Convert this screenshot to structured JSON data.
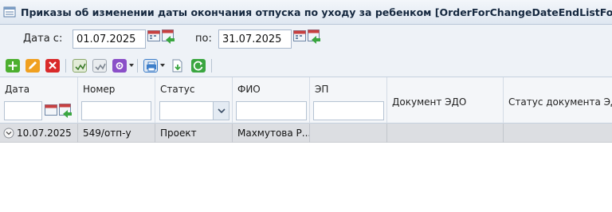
{
  "window": {
    "title": "Приказы об изменении даты окончания отпуска по уходу за ребенком [OrderForChangeDateEndListForm]",
    "icon": "list-window-icon"
  },
  "filter": {
    "date_from_label": "Дата с:",
    "date_from_value": "01.07.2025",
    "date_to_label": "по:",
    "date_to_value": "31.07.2025"
  },
  "toolbar": {
    "buttons": [
      "add-icon",
      "edit-icon",
      "delete-icon",
      "sign-icon",
      "verify-signature-icon",
      "settings-icon",
      "print-icon",
      "export-icon",
      "refresh-icon"
    ],
    "colors": {
      "add": "#4caf2f",
      "edit": "#f0a020",
      "delete": "#d92a2a",
      "settings": "#8a4fc8",
      "print": "#3d7ec9",
      "refresh": "#3aa640"
    }
  },
  "grid": {
    "columns": [
      "Дата",
      "Номер",
      "Статус",
      "ФИО",
      "ЭП",
      "Документ ЭДО",
      "Статус документа ЭДО"
    ],
    "rows": [
      {
        "date": "10.07.2025",
        "number": "549/отп-у",
        "status": "Проект",
        "fio": "Махмутова Р...",
        "ep": "",
        "edo_doc": "",
        "edo_status": ""
      }
    ]
  }
}
